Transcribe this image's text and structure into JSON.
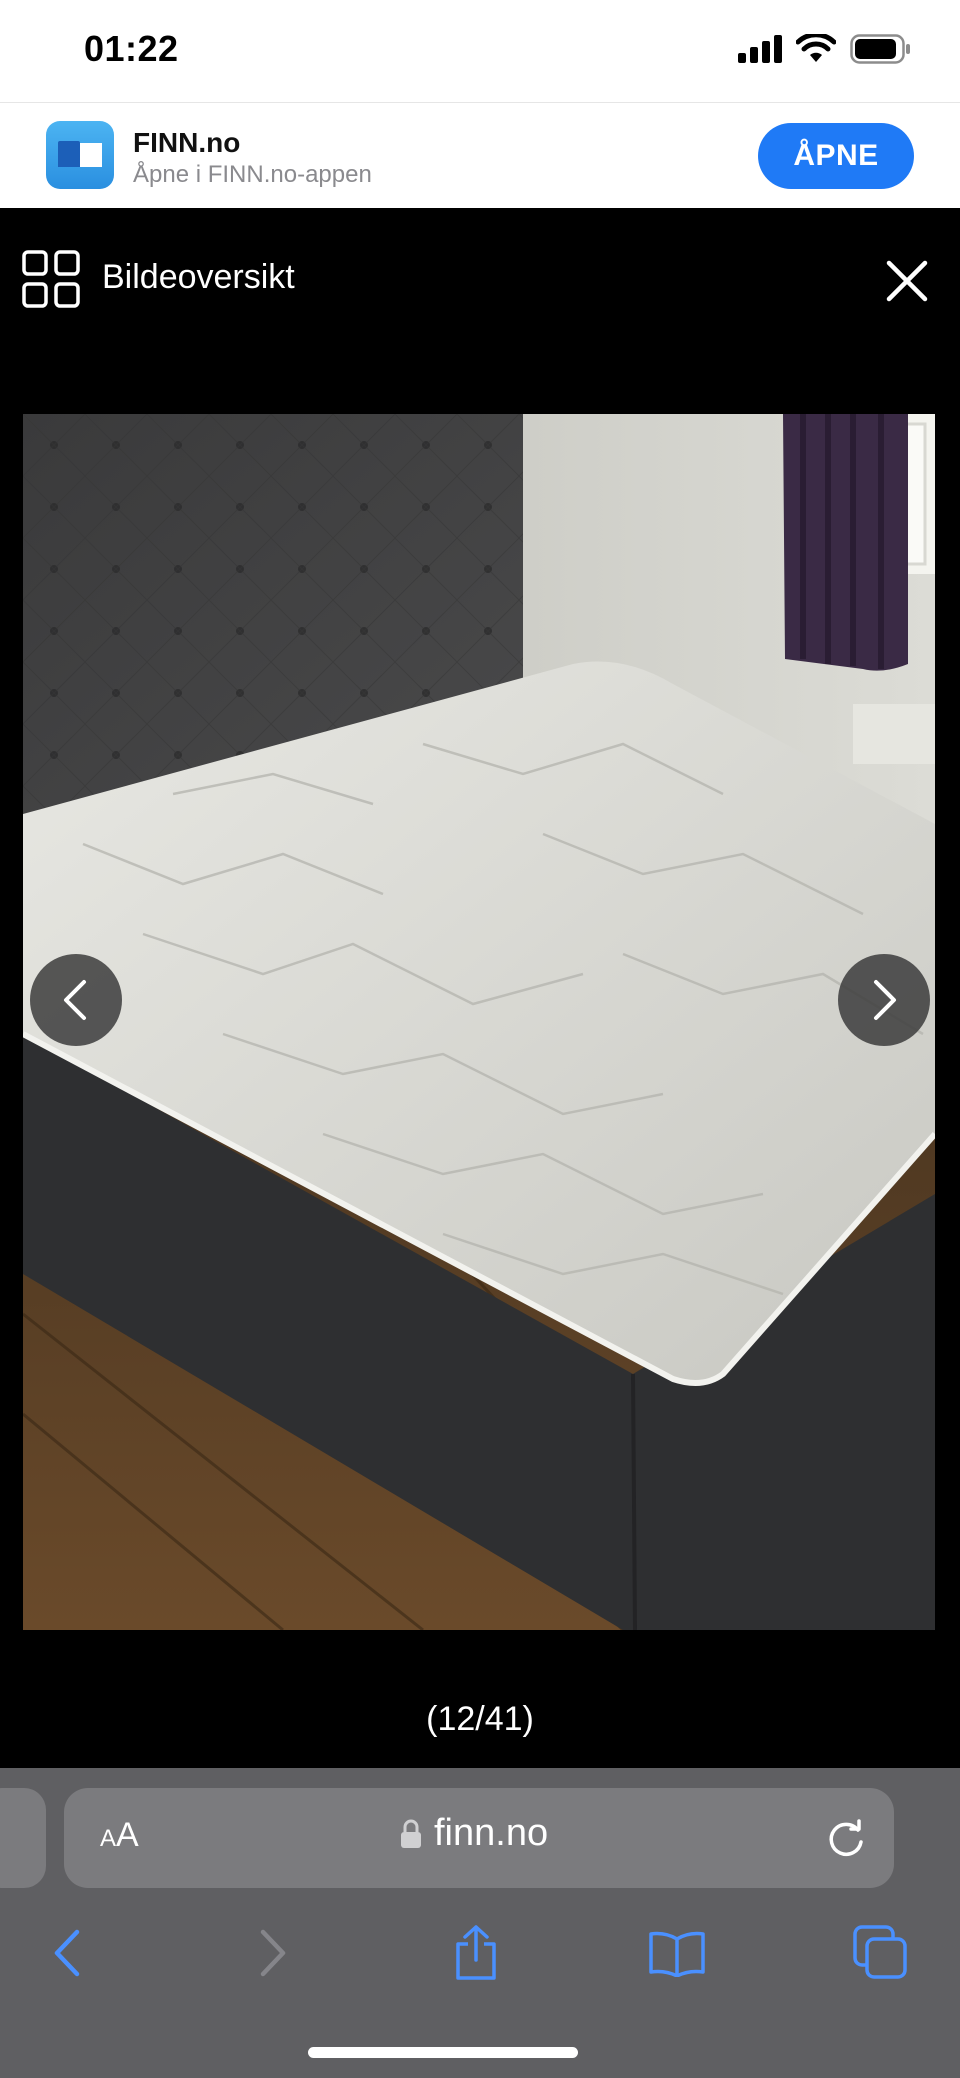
{
  "status_bar": {
    "time": "01:22",
    "icons": [
      "cellular-signal-icon",
      "wifi-icon",
      "battery-icon"
    ]
  },
  "app_banner": {
    "app_name": "FINN.no",
    "subtitle": "Åpne i FINN.no-appen",
    "open_label": "ÅPNE",
    "accent": "#1f7af6"
  },
  "gallery": {
    "title": "Bildeoversikt",
    "counter": "(12/41)",
    "image_description_icon": "photo-bed",
    "icons": [
      "grid-icon",
      "close-icon",
      "chevron-left-icon",
      "chevron-right-icon"
    ]
  },
  "safari": {
    "aa_small": "A",
    "aa_large": "A",
    "url": "finn.no",
    "toolbar": [
      "back-icon",
      "forward-icon",
      "share-icon",
      "bookmarks-icon",
      "tabs-icon"
    ],
    "accent": "#4a90ff"
  }
}
